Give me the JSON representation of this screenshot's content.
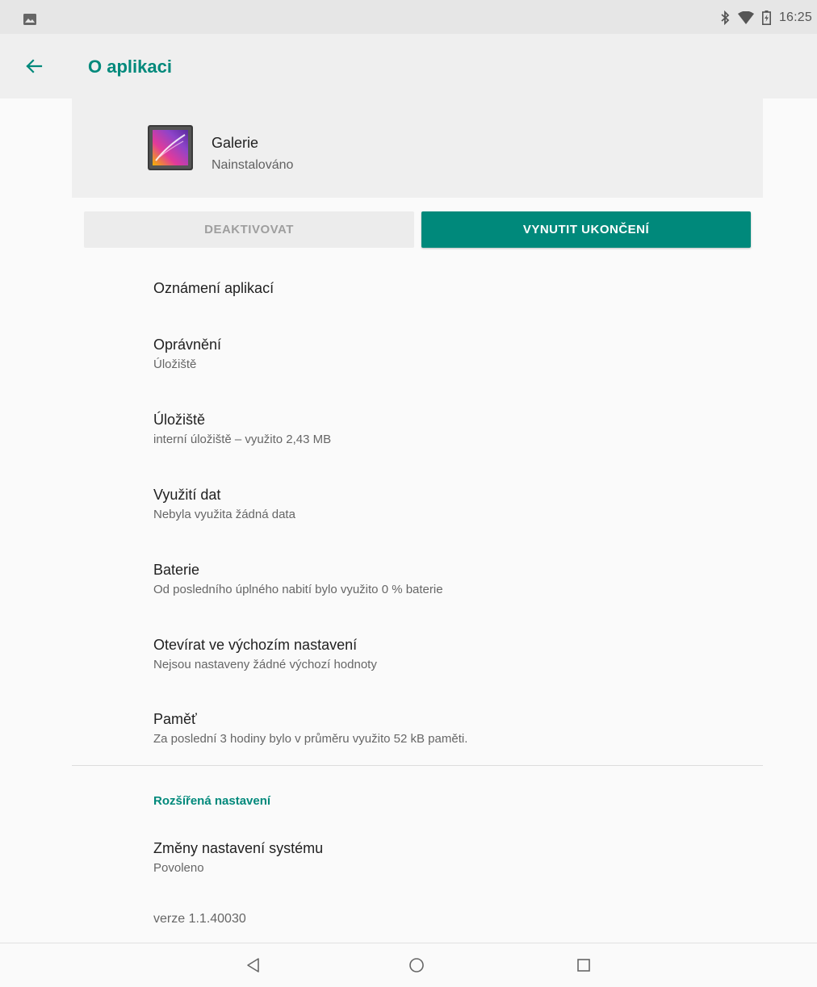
{
  "status_bar": {
    "time": "16:25",
    "left_icon": "image-notification-icon",
    "icons": [
      "bluetooth-icon",
      "wifi-icon",
      "battery-icon"
    ]
  },
  "app_bar": {
    "back_icon": "arrow-back-icon",
    "title": "O aplikaci"
  },
  "app_header": {
    "icon": "gallery-app-icon",
    "name": "Galerie",
    "status": "Nainstalováno"
  },
  "actions": {
    "disable_label": "DEAKTIVOVAT",
    "force_stop_label": "VYNUTIT UKONČENÍ"
  },
  "settings_items": [
    {
      "title": "Oznámení aplikací",
      "subtitle": ""
    },
    {
      "title": "Oprávnění",
      "subtitle": "Úložiště"
    },
    {
      "title": "Úložiště",
      "subtitle": "interní úložiště – využito 2,43 MB"
    },
    {
      "title": "Využití dat",
      "subtitle": "Nebyla využita žádná data"
    },
    {
      "title": "Baterie",
      "subtitle": "Od posledního úplného nabití bylo využito 0 % baterie"
    },
    {
      "title": "Otevírat ve výchozím nastavení",
      "subtitle": "Nejsou nastaveny žádné výchozí hodnoty"
    },
    {
      "title": "Paměť",
      "subtitle": "Za poslední 3 hodiny bylo v průměru využito 52 kB paměti."
    }
  ],
  "advanced": {
    "section_title": "Rozšířená nastavení",
    "item_title": "Změny nastavení systému",
    "item_subtitle": "Povoleno"
  },
  "version": "verze 1.1.40030",
  "nav_bar": {
    "icons": [
      "back-triangle-icon",
      "home-circle-icon",
      "recents-square-icon"
    ]
  },
  "colors": {
    "accent": "#00897b",
    "status_bar_bg": "#e6e6e6",
    "app_bar_bg": "#efefef",
    "background": "#fafafa"
  }
}
